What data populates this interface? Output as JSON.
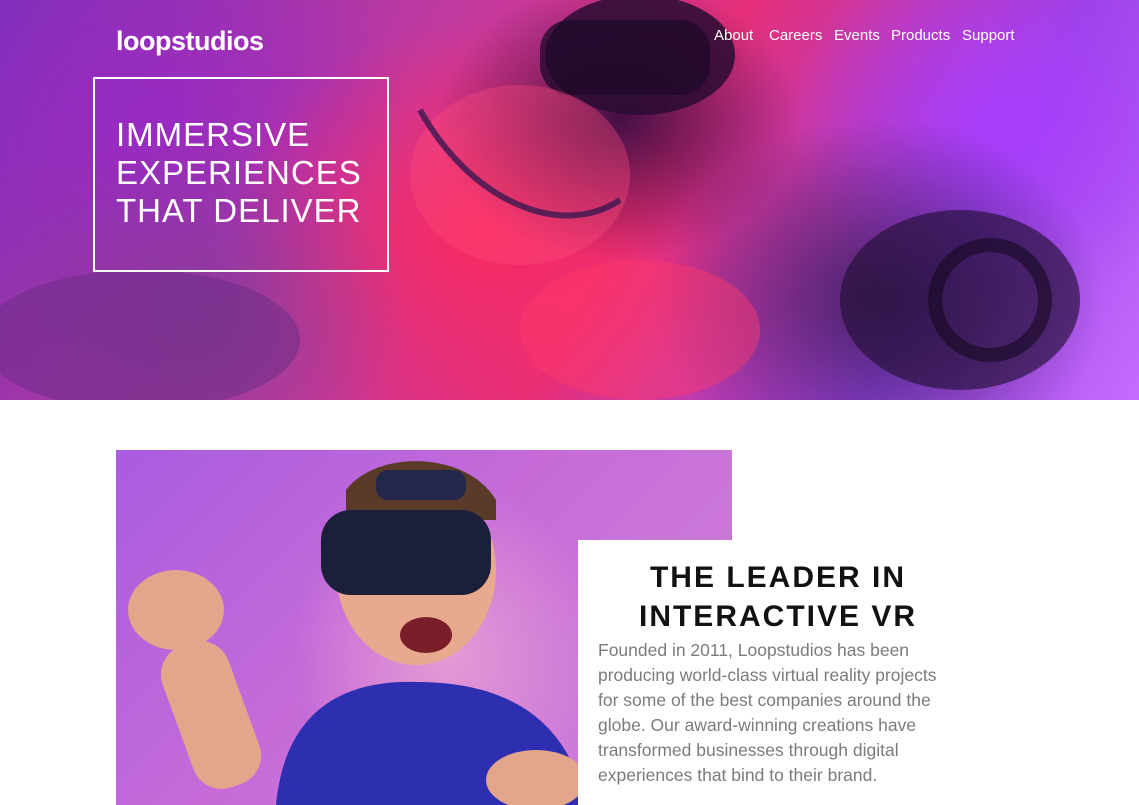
{
  "brand": {
    "logo_text": "loopstudios"
  },
  "nav": {
    "items": [
      {
        "label": "About"
      },
      {
        "label": "Careers"
      },
      {
        "label": "Events"
      },
      {
        "label": "Products"
      },
      {
        "label": "Support"
      }
    ]
  },
  "hero": {
    "title_lines": [
      "IMMERSIVE",
      "EXPERIENCES",
      "THAT DELIVER"
    ]
  },
  "about": {
    "title_lines": [
      "THE LEADER IN",
      "INTERACTIVE VR"
    ],
    "body": "Founded in 2011, Loopstudios has been producing world-class virtual reality projects for some of the best companies around the globe. Our award-winning creations have transformed businesses through digital experiences that bind to their brand."
  },
  "colors": {
    "hero_purple": "#7b2fb8",
    "hero_pink": "#e6307a",
    "photo_violet": "#b468e0",
    "text_dark": "#111111",
    "text_gray": "#7b7b7b"
  }
}
